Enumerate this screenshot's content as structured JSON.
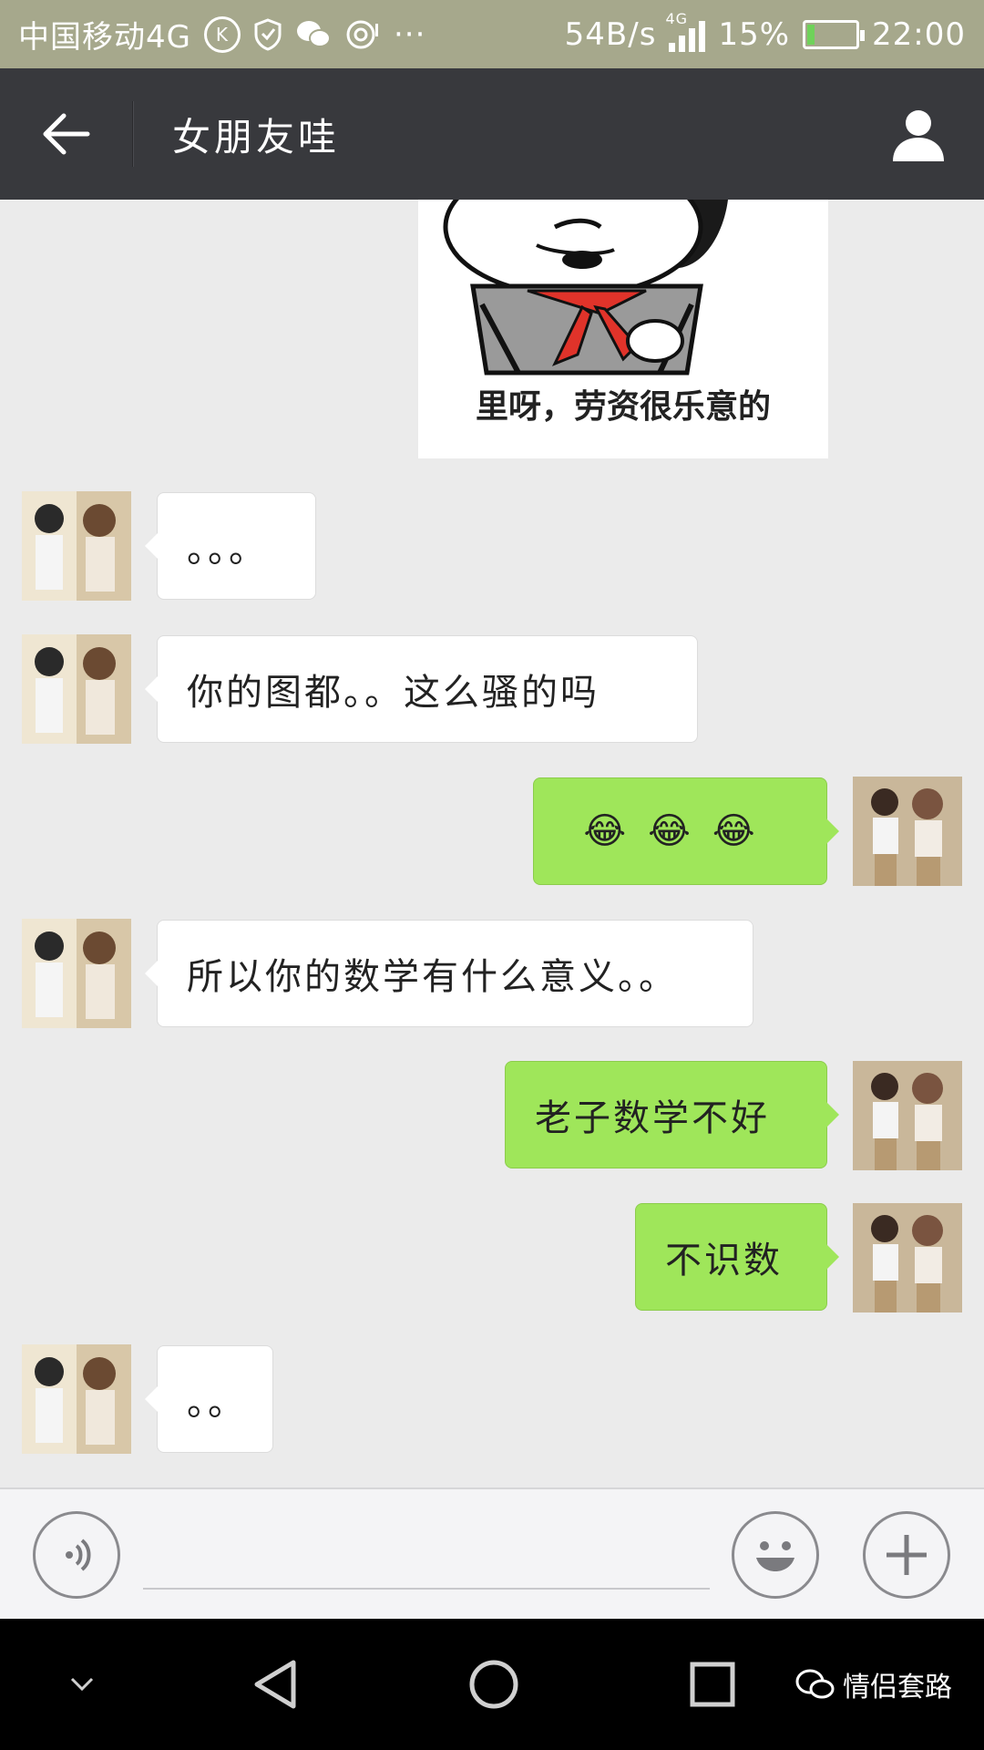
{
  "status_bar": {
    "carrier": "中国移动4G",
    "speed": "54B/s",
    "network": "4G",
    "battery": "15%",
    "battery_level": 0.15,
    "time": "22:00"
  },
  "header": {
    "title": "女朋友哇"
  },
  "sticker": {
    "caption": "里呀，劳资很乐意的"
  },
  "messages": [
    {
      "side": "left",
      "text": "。。。"
    },
    {
      "side": "left",
      "text": "你的图都。。这么骚的吗"
    },
    {
      "side": "right",
      "text": "😂😂😂"
    },
    {
      "side": "left",
      "text": "所以你的数学有什么意义。。"
    },
    {
      "side": "right",
      "text": "老子数学不好"
    },
    {
      "side": "right",
      "text": "不识数"
    },
    {
      "side": "left",
      "text": "。。"
    }
  ],
  "input": {
    "placeholder": ""
  },
  "watermark": {
    "text": "情侣套路"
  },
  "colors": {
    "title_bar": "#38393d",
    "sent_bubble": "#9fe65a",
    "received_bubble": "#ffffff",
    "chat_background": "#ebebeb"
  }
}
